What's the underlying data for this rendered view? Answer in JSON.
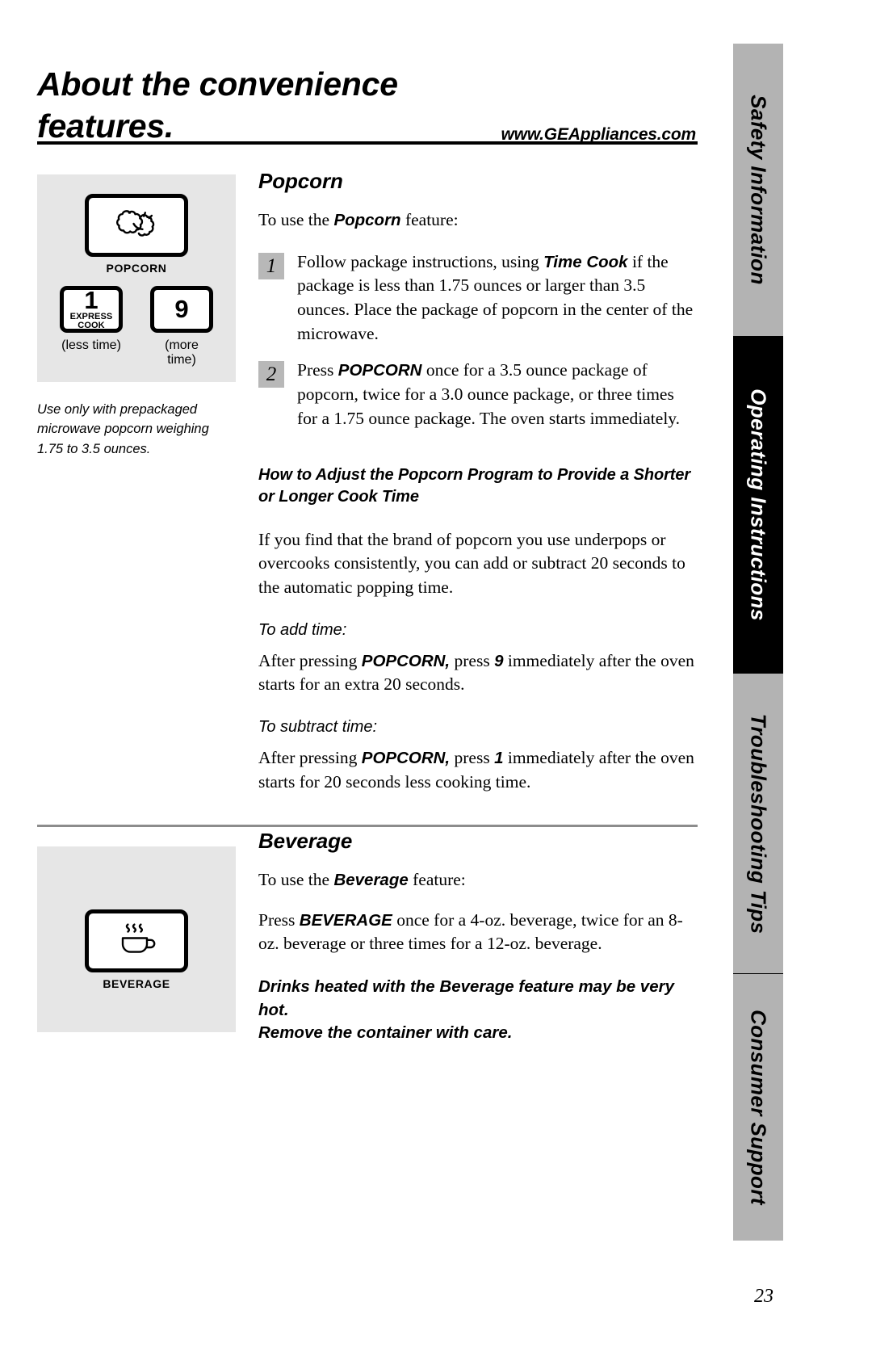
{
  "header": {
    "title": "About the convenience features.",
    "title_line1": "About the convenience",
    "title_line2": "features.",
    "website": "www.GEAppliances.com"
  },
  "sidebar": {
    "tabs": [
      {
        "label": "Safety Information",
        "state": "inactive",
        "bg": "#b3b3b3",
        "fg": "#000000"
      },
      {
        "label": "Operating Instructions",
        "state": "active",
        "bg": "#000000",
        "fg": "#ffffff"
      },
      {
        "label": "Troubleshooting Tips",
        "state": "inactive",
        "bg": "#b3b3b3",
        "fg": "#000000"
      },
      {
        "label": "Consumer Support",
        "state": "inactive",
        "bg": "#b3b3b3",
        "fg": "#000000"
      }
    ]
  },
  "popcorn_panel": {
    "popcorn_button_label": "POPCORN",
    "popcorn_button_icon": "popcorn-icon",
    "less_button": {
      "digit": "1",
      "sub": "EXPRESS COOK",
      "caption": "(less time)"
    },
    "more_button": {
      "digit": "9",
      "sub": "",
      "caption": "(more time)"
    },
    "caption": "Use only with prepackaged microwave popcorn weighing 1.75 to 3.5 ounces."
  },
  "popcorn_section": {
    "heading": "Popcorn",
    "intro_pre": "To use the ",
    "intro_bold": "Popcorn",
    "intro_post": " feature:",
    "steps": [
      {
        "number": "1",
        "pre": "Follow package instructions, using ",
        "bold": "Time Cook",
        "post": " if the package is less than 1.75 ounces or larger than 3.5 ounces. Place the package of popcorn in the center of the microwave."
      },
      {
        "number": "2",
        "pre": "Press ",
        "bold": "POPCORN",
        "post": " once for a 3.5 ounce package of popcorn, twice for a 3.0 ounce package, or three times for a 1.75 ounce package. The oven starts immediately."
      }
    ],
    "adjust_heading_line1": "How to Adjust the Popcorn Program to Provide a Shorter",
    "adjust_heading_line2": "or Longer Cook Time",
    "adjust_body": "If you find that the brand of popcorn you use underpops or overcooks consistently, you can add or subtract 20 seconds to the automatic popping time.",
    "add_time": {
      "label": "To add time:",
      "pre": "After pressing ",
      "bold": "POPCORN,",
      "mid": " press ",
      "key": "9",
      "post": " immediately after the oven starts for an extra 20 seconds."
    },
    "subtract_time": {
      "label": "To subtract time:",
      "pre": "After pressing ",
      "bold": "POPCORN,",
      "mid": " press ",
      "key": "1",
      "post": " immediately after the oven starts for 20 seconds less cooking time."
    }
  },
  "beverage_panel": {
    "beverage_button_label": "BEVERAGE",
    "beverage_button_icon": "steaming-cup-icon"
  },
  "beverage_section": {
    "heading": "Beverage",
    "intro_pre": "To use the ",
    "intro_bold": "Beverage",
    "intro_post": " feature:",
    "press_pre": "Press ",
    "press_bold": "BEVERAGE",
    "press_post": " once for a 4-oz. beverage, twice for an 8-oz. beverage or three times for a 12-oz. beverage.",
    "warning_line1": "Drinks heated with the Beverage feature may be very hot.",
    "warning_line2": "Remove the container with care."
  },
  "footer": {
    "page_number": "23"
  },
  "colors": {
    "panel_bg": "#e6e6e6",
    "tab_gray": "#b3b3b3",
    "tab_black": "#000000",
    "rule_gray": "#8c8c8c",
    "step_box_gray": "#b8b8b8"
  }
}
